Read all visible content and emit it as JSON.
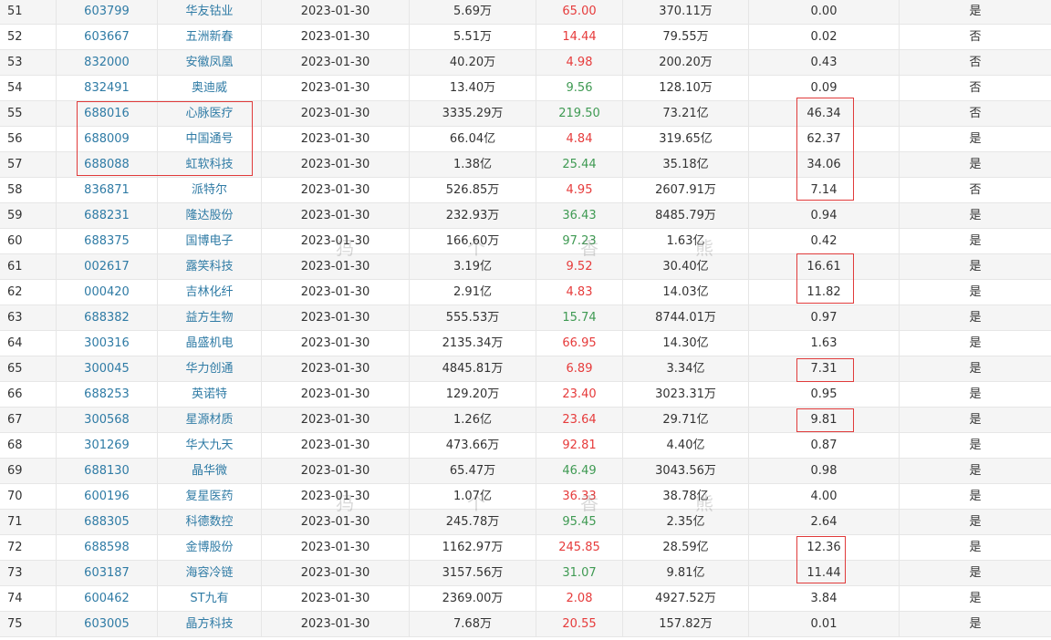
{
  "table": {
    "rows": [
      {
        "idx": "51",
        "code": "603799",
        "name": "华友钴业",
        "date": "2023-01-30",
        "vol": "5.69万",
        "pct": "65.00",
        "pct_color": "red",
        "amt": "370.11万",
        "val": "0.00",
        "flag": "是"
      },
      {
        "idx": "52",
        "code": "603667",
        "name": "五洲新春",
        "date": "2023-01-30",
        "vol": "5.51万",
        "pct": "14.44",
        "pct_color": "red",
        "amt": "79.55万",
        "val": "0.02",
        "flag": "否"
      },
      {
        "idx": "53",
        "code": "832000",
        "name": "安徽凤凰",
        "date": "2023-01-30",
        "vol": "40.20万",
        "pct": "4.98",
        "pct_color": "red",
        "amt": "200.20万",
        "val": "0.43",
        "flag": "否"
      },
      {
        "idx": "54",
        "code": "832491",
        "name": "奥迪威",
        "date": "2023-01-30",
        "vol": "13.40万",
        "pct": "9.56",
        "pct_color": "green",
        "amt": "128.10万",
        "val": "0.09",
        "flag": "否"
      },
      {
        "idx": "55",
        "code": "688016",
        "name": "心脉医疗",
        "date": "2023-01-30",
        "vol": "3335.29万",
        "pct": "219.50",
        "pct_color": "green",
        "amt": "73.21亿",
        "val": "46.34",
        "flag": "否"
      },
      {
        "idx": "56",
        "code": "688009",
        "name": "中国通号",
        "date": "2023-01-30",
        "vol": "66.04亿",
        "pct": "4.84",
        "pct_color": "red",
        "amt": "319.65亿",
        "val": "62.37",
        "flag": "是"
      },
      {
        "idx": "57",
        "code": "688088",
        "name": "虹软科技",
        "date": "2023-01-30",
        "vol": "1.38亿",
        "pct": "25.44",
        "pct_color": "green",
        "amt": "35.18亿",
        "val": "34.06",
        "flag": "是"
      },
      {
        "idx": "58",
        "code": "836871",
        "name": "派特尔",
        "date": "2023-01-30",
        "vol": "526.85万",
        "pct": "4.95",
        "pct_color": "red",
        "amt": "2607.91万",
        "val": "7.14",
        "flag": "否"
      },
      {
        "idx": "59",
        "code": "688231",
        "name": "隆达股份",
        "date": "2023-01-30",
        "vol": "232.93万",
        "pct": "36.43",
        "pct_color": "green",
        "amt": "8485.79万",
        "val": "0.94",
        "flag": "是"
      },
      {
        "idx": "60",
        "code": "688375",
        "name": "国博电子",
        "date": "2023-01-30",
        "vol": "166.60万",
        "pct": "97.23",
        "pct_color": "green",
        "amt": "1.63亿",
        "val": "0.42",
        "flag": "是"
      },
      {
        "idx": "61",
        "code": "002617",
        "name": "露笑科技",
        "date": "2023-01-30",
        "vol": "3.19亿",
        "pct": "9.52",
        "pct_color": "red",
        "amt": "30.40亿",
        "val": "16.61",
        "flag": "是"
      },
      {
        "idx": "62",
        "code": "000420",
        "name": "吉林化纤",
        "date": "2023-01-30",
        "vol": "2.91亿",
        "pct": "4.83",
        "pct_color": "red",
        "amt": "14.03亿",
        "val": "11.82",
        "flag": "是"
      },
      {
        "idx": "63",
        "code": "688382",
        "name": "益方生物",
        "date": "2023-01-30",
        "vol": "555.53万",
        "pct": "15.74",
        "pct_color": "green",
        "amt": "8744.01万",
        "val": "0.97",
        "flag": "是"
      },
      {
        "idx": "64",
        "code": "300316",
        "name": "晶盛机电",
        "date": "2023-01-30",
        "vol": "2135.34万",
        "pct": "66.95",
        "pct_color": "red",
        "amt": "14.30亿",
        "val": "1.63",
        "flag": "是"
      },
      {
        "idx": "65",
        "code": "300045",
        "name": "华力创通",
        "date": "2023-01-30",
        "vol": "4845.81万",
        "pct": "6.89",
        "pct_color": "red",
        "amt": "3.34亿",
        "val": "7.31",
        "flag": "是"
      },
      {
        "idx": "66",
        "code": "688253",
        "name": "英诺特",
        "date": "2023-01-30",
        "vol": "129.20万",
        "pct": "23.40",
        "pct_color": "red",
        "amt": "3023.31万",
        "val": "0.95",
        "flag": "是"
      },
      {
        "idx": "67",
        "code": "300568",
        "name": "星源材质",
        "date": "2023-01-30",
        "vol": "1.26亿",
        "pct": "23.64",
        "pct_color": "red",
        "amt": "29.71亿",
        "val": "9.81",
        "flag": "是"
      },
      {
        "idx": "68",
        "code": "301269",
        "name": "华大九天",
        "date": "2023-01-30",
        "vol": "473.66万",
        "pct": "92.81",
        "pct_color": "red",
        "amt": "4.40亿",
        "val": "0.87",
        "flag": "是"
      },
      {
        "idx": "69",
        "code": "688130",
        "name": "晶华微",
        "date": "2023-01-30",
        "vol": "65.47万",
        "pct": "46.49",
        "pct_color": "green",
        "amt": "3043.56万",
        "val": "0.98",
        "flag": "是"
      },
      {
        "idx": "70",
        "code": "600196",
        "name": "复星医药",
        "date": "2023-01-30",
        "vol": "1.07亿",
        "pct": "36.33",
        "pct_color": "red",
        "amt": "38.78亿",
        "val": "4.00",
        "flag": "是"
      },
      {
        "idx": "71",
        "code": "688305",
        "name": "科德数控",
        "date": "2023-01-30",
        "vol": "245.78万",
        "pct": "95.45",
        "pct_color": "green",
        "amt": "2.35亿",
        "val": "2.64",
        "flag": "是"
      },
      {
        "idx": "72",
        "code": "688598",
        "name": "金博股份",
        "date": "2023-01-30",
        "vol": "1162.97万",
        "pct": "245.85",
        "pct_color": "red",
        "amt": "28.59亿",
        "val": "12.36",
        "flag": "是"
      },
      {
        "idx": "73",
        "code": "603187",
        "name": "海容冷链",
        "date": "2023-01-30",
        "vol": "3157.56万",
        "pct": "31.07",
        "pct_color": "green",
        "amt": "9.81亿",
        "val": "11.44",
        "flag": "是"
      },
      {
        "idx": "74",
        "code": "600462",
        "name": "ST九有",
        "date": "2023-01-30",
        "vol": "2369.00万",
        "pct": "2.08",
        "pct_color": "red",
        "amt": "4927.52万",
        "val": "3.84",
        "flag": "是"
      },
      {
        "idx": "75",
        "code": "603005",
        "name": "晶方科技",
        "date": "2023-01-30",
        "vol": "7.68万",
        "pct": "20.55",
        "pct_color": "red",
        "amt": "157.82万",
        "val": "0.01",
        "flag": "是"
      }
    ]
  },
  "colors": {
    "link": "#2f7ba5",
    "up": "#e63b3b",
    "down": "#3f9a53",
    "highlight_box": "#e03a3a"
  },
  "watermark": {
    "chars": [
      "犸",
      "个",
      "香",
      "熊"
    ]
  }
}
